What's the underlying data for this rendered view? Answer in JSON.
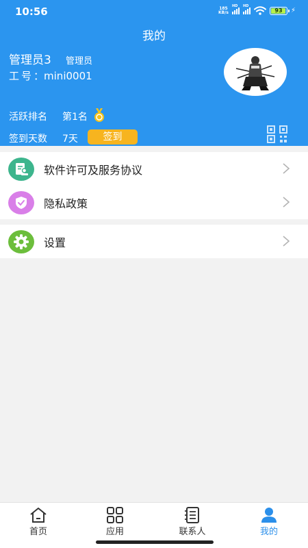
{
  "status_bar": {
    "time": "10:56",
    "net_speed_value": "185",
    "net_speed_unit": "KB/s",
    "signal_tag": "HD",
    "battery": "93"
  },
  "header": {
    "title": "我的",
    "user_name": "管理员3",
    "user_role": "管理员",
    "emp_no_label": "工号",
    "emp_no_separator": "：",
    "emp_no": "mini0001",
    "rank_label": "活跃排名",
    "rank_value": "第1名",
    "signin_days_label": "签到天数",
    "signin_days_value": "7天",
    "signin_button": "签到"
  },
  "menu": {
    "group1": [
      {
        "label": "软件许可及服务协议",
        "icon": "document-stamp-icon",
        "icon_bg": "#3db58d"
      },
      {
        "label": "隐私政策",
        "icon": "shield-check-icon",
        "icon_bg": "#d97fe8"
      }
    ],
    "group2": [
      {
        "label": "设置",
        "icon": "gear-icon",
        "icon_bg": "#6cbe3c"
      }
    ]
  },
  "tabbar": {
    "items": [
      {
        "label": "首页",
        "icon": "home-icon"
      },
      {
        "label": "应用",
        "icon": "apps-grid-icon"
      },
      {
        "label": "联系人",
        "icon": "contacts-book-icon"
      },
      {
        "label": "我的",
        "icon": "person-icon"
      }
    ],
    "active_index": 3
  },
  "colors": {
    "header_bg": "#2b95ef",
    "accent": "#2b8fea",
    "signin_button_bg": "#f7b41f",
    "page_bg": "#f2f2f2"
  }
}
